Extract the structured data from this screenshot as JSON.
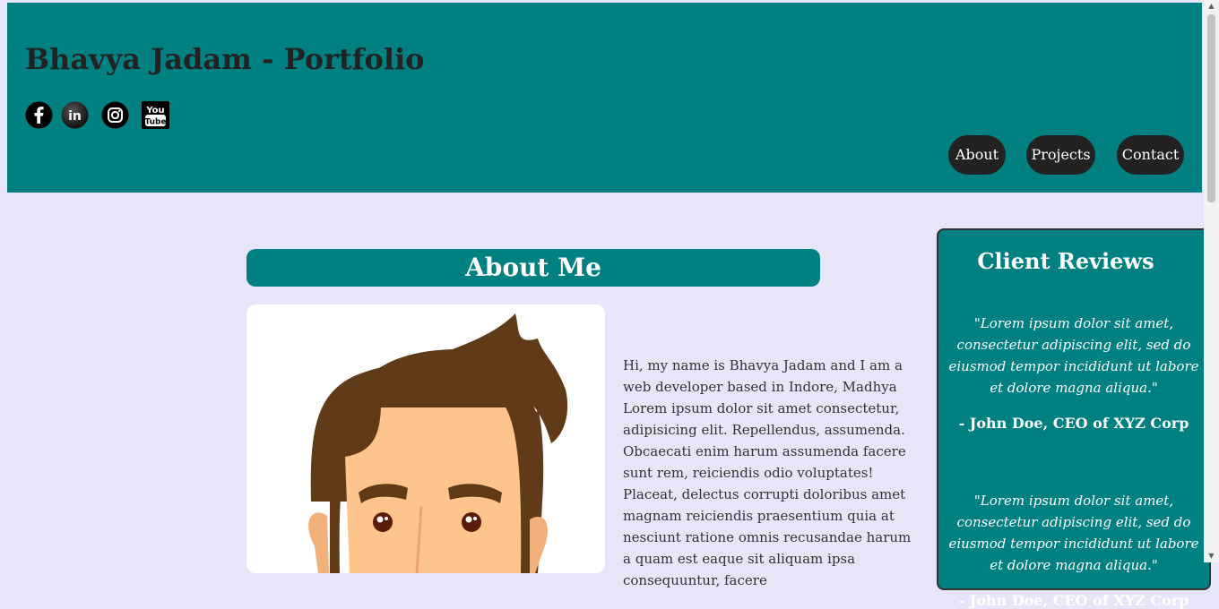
{
  "header": {
    "title": "Bhavya Jadam - Portfolio",
    "social": [
      {
        "name": "facebook-icon"
      },
      {
        "name": "linkedin-icon",
        "text": "in"
      },
      {
        "name": "instagram-icon"
      },
      {
        "name": "youtube-icon",
        "text_top": "You",
        "text_bottom": "Tube"
      }
    ],
    "nav": [
      "About",
      "Projects",
      "Contact"
    ]
  },
  "about": {
    "heading": "About Me",
    "text": "Hi, my name is Bhavya Jadam and I am a web developer based in Indore, Madhya Lorem ipsum dolor sit amet consectetur, adipisicing elit. Repellendus, assumenda. Obcaecati enim harum assumenda facere sunt rem, reiciendis odio voluptates! Placeat, delectus corrupti doloribus amet magnam reiciendis praesentium quia at nesciunt ratione omnis recusandae harum a quam est eaque sit aliquam ipsa consequuntur, facere"
  },
  "reviews": {
    "title": "Client Reviews",
    "items": [
      {
        "quote": "\"Lorem ipsum dolor sit amet, consectetur adipiscing elit, sed do eiusmod tempor incididunt ut labore et dolore magna aliqua.\"",
        "author": "- John Doe, CEO of XYZ Corp"
      },
      {
        "quote": "\"Lorem ipsum dolor sit amet, consectetur adipiscing elit, sed do eiusmod tempor incididunt ut labore et dolore magna aliqua.\"",
        "author": "- John Doe, CEO of XYZ Corp"
      }
    ]
  },
  "colors": {
    "header_bg": "#008080",
    "page_bg": "#e6e6f8",
    "nav_button_bg": "#222222"
  }
}
